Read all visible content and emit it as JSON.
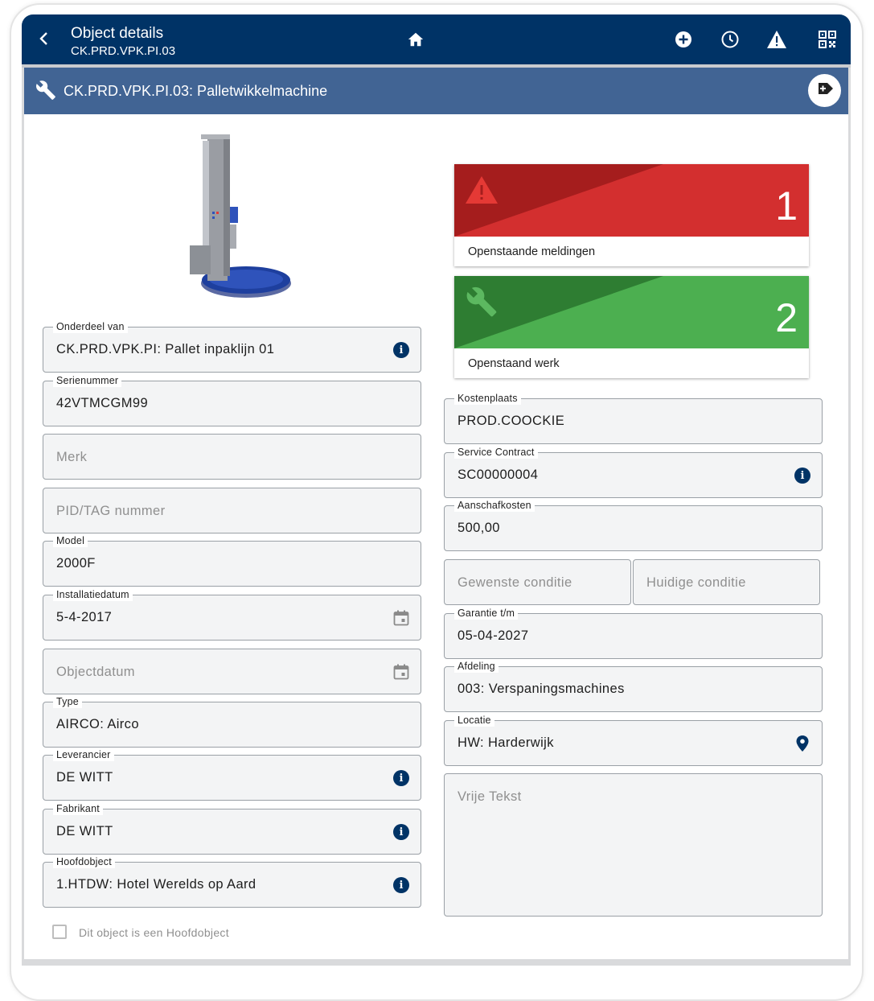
{
  "appbar": {
    "title": "Object details",
    "subtitle": "CK.PRD.VPK.PI.03"
  },
  "object_bar": {
    "title": "CK.PRD.VPK.PI.03: Palletwikkelmachine"
  },
  "tiles": {
    "notifications": {
      "count": "1",
      "label": "Openstaande meldingen",
      "color": "#d32f2f"
    },
    "work": {
      "count": "2",
      "label": "Openstaand werk",
      "color": "#4caf50"
    }
  },
  "left_fields": {
    "onderdeel_van": {
      "label": "Onderdeel van",
      "value": "CK.PRD.VPK.PI: Pallet inpaklijn 01"
    },
    "serienummer": {
      "label": "Serienummer",
      "value": "42VTMCGM99"
    },
    "merk": {
      "placeholder": "Merk"
    },
    "pid_tag": {
      "placeholder": "PID/TAG nummer"
    },
    "model": {
      "label": "Model",
      "value": "2000F"
    },
    "installatiedatum": {
      "label": "Installatiedatum",
      "value": "5-4-2017"
    },
    "objectdatum": {
      "placeholder": "Objectdatum"
    },
    "type": {
      "label": "Type",
      "value": "AIRCO: Airco"
    },
    "leverancier": {
      "label": "Leverancier",
      "value": "DE WITT"
    },
    "fabrikant": {
      "label": "Fabrikant",
      "value": "DE WITT"
    },
    "hoofdobject": {
      "label": "Hoofdobject",
      "value": "1.HTDW: Hotel Werelds op Aard"
    }
  },
  "right_fields": {
    "kostenplaats": {
      "label": "Kostenplaats",
      "value": "PROD.COOCKIE"
    },
    "service_contract": {
      "label": "Service Contract",
      "value": "SC00000004"
    },
    "aanschafkosten": {
      "label": "Aanschafkosten",
      "value": "500,00"
    },
    "gewenste_conditie": {
      "placeholder": "Gewenste conditie"
    },
    "huidige_conditie": {
      "placeholder": "Huidige conditie"
    },
    "garantie": {
      "label": "Garantie t/m",
      "value": "05-04-2027"
    },
    "afdeling": {
      "label": "Afdeling",
      "value": "003: Verspaningsmachines"
    },
    "locatie": {
      "label": "Locatie",
      "value": "HW: Harderwijk"
    },
    "vrije_tekst": {
      "placeholder": "Vrije Tekst"
    }
  },
  "checkbox": {
    "label": "Dit object is een Hoofdobject",
    "checked": false
  },
  "colors": {
    "header": "#003366",
    "object_bar": "#416494",
    "accent": "#003366"
  },
  "icons": [
    "back-icon",
    "home-icon",
    "add-circle-icon",
    "clock-icon",
    "warning-icon",
    "qr-code-icon",
    "wrench-icon",
    "add-tag-icon",
    "info-icon",
    "calendar-icon",
    "location-pin-icon"
  ]
}
